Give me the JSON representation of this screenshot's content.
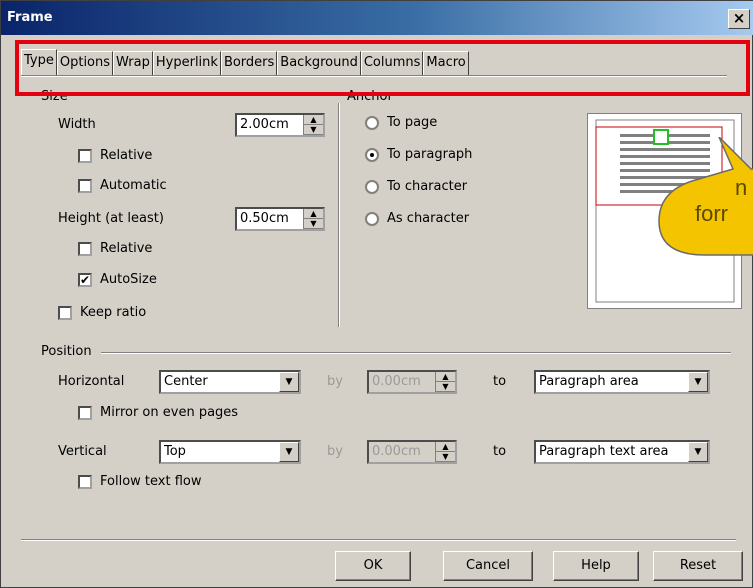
{
  "window": {
    "title": "Frame",
    "close_glyph": "×"
  },
  "tabs": [
    "Type",
    "Options",
    "Wrap",
    "Hyperlink",
    "Borders",
    "Background",
    "Columns",
    "Macro"
  ],
  "size": {
    "group_label": "Size",
    "width_label": "Width",
    "width_value": "2.00cm",
    "width_relative_label": "Relative",
    "automatic_label": "Automatic",
    "height_label": "Height (at least)",
    "height_value": "0.50cm",
    "height_relative_label": "Relative",
    "autosize_label": "AutoSize",
    "keep_ratio_label": "Keep ratio"
  },
  "anchor": {
    "group_label": "Anchor",
    "options": [
      "To page",
      "To paragraph",
      "To character",
      "As character"
    ],
    "selected": "To paragraph"
  },
  "position": {
    "group_label": "Position",
    "horizontal_label": "Horizontal",
    "horizontal_value": "Center",
    "by_label": "by",
    "horizontal_by_value": "0.00cm",
    "to_label": "to",
    "horizontal_to_value": "Paragraph area",
    "mirror_label": "Mirror on even pages",
    "vertical_label": "Vertical",
    "vertical_value": "Top",
    "vertical_by_value": "0.00cm",
    "vertical_to_value": "Paragraph text area",
    "follow_label": "Follow text flow"
  },
  "buttons": {
    "ok": "OK",
    "cancel": "Cancel",
    "help": "Help",
    "reset": "Reset"
  },
  "tooltip": {
    "line1": "n",
    "line2": "forr"
  },
  "checks": {
    "autosize": "✔"
  },
  "colors": {
    "highlight": "#e3000f",
    "tooltip_fill": "#f5c400",
    "title_bar": "#0a246a",
    "preview_frame": "#cc0000",
    "anchor_marker": "#20c020"
  }
}
